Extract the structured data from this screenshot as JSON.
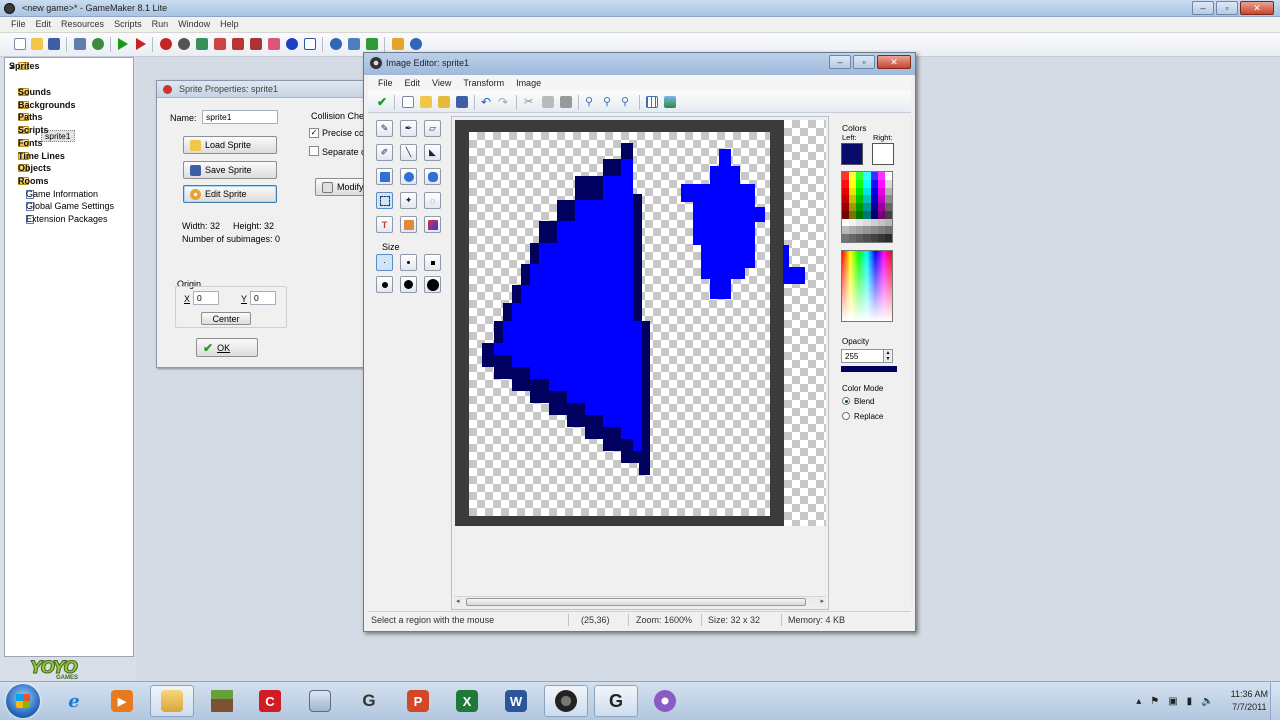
{
  "main_window": {
    "title": "<new game>* - GameMaker 8.1 Lite",
    "controls": [
      "–",
      "▫",
      "✕"
    ],
    "menu": [
      "File",
      "Edit",
      "Resources",
      "Scripts",
      "Run",
      "Window",
      "Help"
    ]
  },
  "resource_tree": {
    "items": [
      {
        "label": "Sprites",
        "bold": true,
        "expanded": true
      },
      {
        "label": "Sounds",
        "bold": true
      },
      {
        "label": "Backgrounds",
        "bold": true
      },
      {
        "label": "Paths",
        "bold": true
      },
      {
        "label": "Scripts",
        "bold": true
      },
      {
        "label": "Fonts",
        "bold": true
      },
      {
        "label": "Time Lines",
        "bold": true
      },
      {
        "label": "Objects",
        "bold": true
      },
      {
        "label": "Rooms",
        "bold": true
      },
      {
        "label": "Game Information",
        "bold": false
      },
      {
        "label": "Global Game Settings",
        "bold": false
      },
      {
        "label": "Extension Packages",
        "bold": false
      }
    ],
    "sprite_child": "sprite1"
  },
  "logo": {
    "text": "YOYO",
    "sub": "GAMES"
  },
  "sprite_props": {
    "title": "Sprite Properties: sprite1",
    "name_label": "Name:",
    "name_value": "sprite1",
    "load_button": "Load Sprite",
    "save_button": "Save Sprite",
    "edit_button": "Edit Sprite",
    "width_text": "Width: 32",
    "height_text": "Height: 32",
    "subimages_text": "Number of subimages: 0",
    "origin_label": "Origin",
    "x_label": "X",
    "x_value": "0",
    "y_label": "Y",
    "y_value": "0",
    "center_button": "Center",
    "ok_button": "OK",
    "collision_label": "Collision Chec",
    "precise_label": "Precise co",
    "separate_label": "Separate c",
    "modify_button": "Modify"
  },
  "image_editor": {
    "title": "Image Editor: sprite1",
    "controls": [
      "–",
      "▫",
      "✕"
    ],
    "menu": [
      "File",
      "Edit",
      "View",
      "Transform",
      "Image"
    ],
    "size_label": "Size",
    "colors": {
      "heading": "Colors",
      "left_label": "Left:",
      "right_label": "Right:",
      "left_color": "#0b0b6e",
      "right_color": "#ffffff",
      "opacity_label": "Opacity",
      "opacity_value": "255",
      "mode_label": "Color Mode",
      "blend_label": "Blend",
      "replace_label": "Replace",
      "mode_selected": "Blend"
    },
    "status": {
      "message": "Select a region with the mouse",
      "coords": "(25,36)",
      "zoom": "Zoom: 1600%",
      "size": "Size: 32 x 32",
      "memory": "Memory: 4 KB"
    },
    "drawing_colors": {
      "fill": "#0000ff",
      "outline": "#00005e"
    }
  },
  "taskbar": {
    "apps": [
      "start",
      "internet-explorer",
      "media-player",
      "file-explorer",
      "minecraft",
      "screen-recorder",
      "calculator",
      "gamemaker",
      "powerpoint",
      "excel",
      "word",
      "camera",
      "gamemaker-active",
      "speed-tool"
    ],
    "time": "11:36 AM",
    "date": "7/7/2011"
  }
}
